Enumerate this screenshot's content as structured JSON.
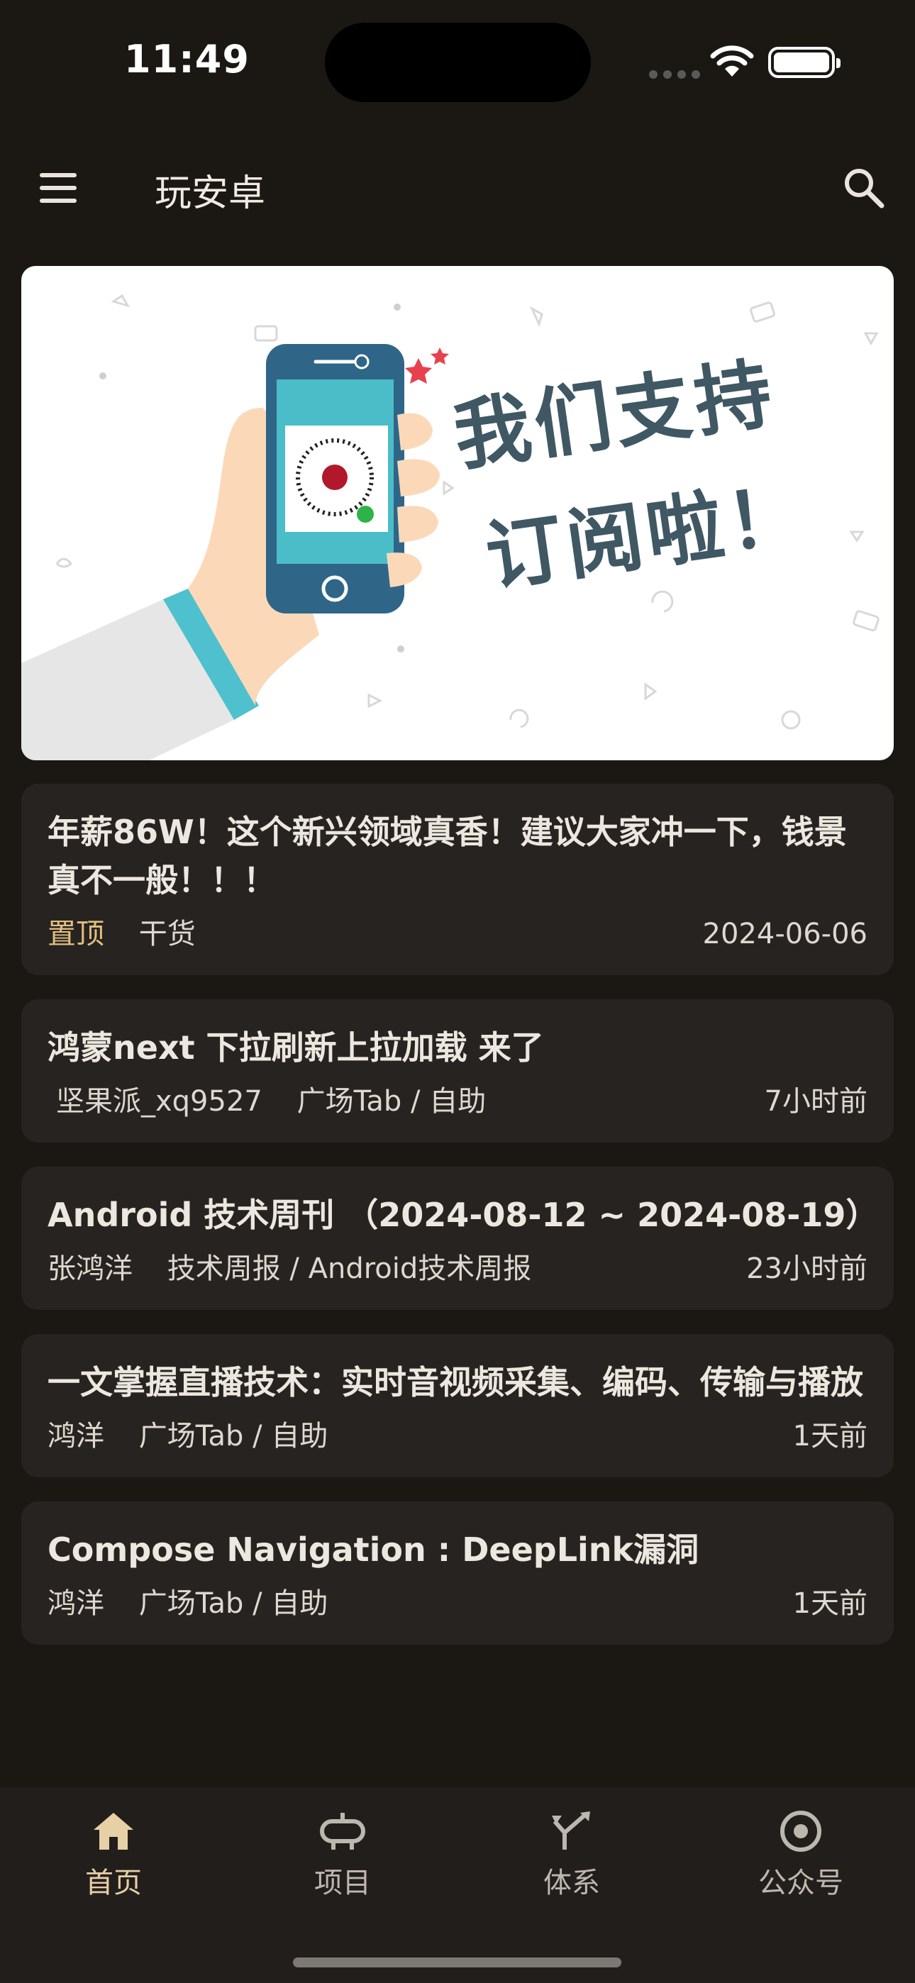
{
  "status_bar": {
    "time": "11:49"
  },
  "app_bar": {
    "title": "玩安卓"
  },
  "banner": {
    "line1": "我们支持",
    "line2": "订阅啦！"
  },
  "articles": [
    {
      "title": "年薪86W！这个新兴领域真香！建议大家冲一下，钱景真不一般！！！",
      "tag": "置顶",
      "category": "干货",
      "author": "",
      "date": "2024-06-06"
    },
    {
      "title": "鸿蒙next 下拉刷新上拉加载 来了",
      "tag": "",
      "author": "坚果派_xq9527",
      "category": "广场Tab / 自助",
      "date": "7小时前"
    },
    {
      "title": "Android 技术周刊 （2024-08-12 ~ 2024-08-19）",
      "tag": "",
      "author": "张鸿洋",
      "category": "技术周报 / Android技术周报",
      "date": "23小时前"
    },
    {
      "title": "一文掌握直播技术：实时音视频采集、编码、传输与播放",
      "tag": "",
      "author": "鸿洋",
      "category": "广场Tab / 自助",
      "date": "1天前"
    },
    {
      "title": "Compose Navigation : DeepLink漏洞",
      "tag": "",
      "author": "鸿洋",
      "category": "广场Tab / 自助",
      "date": "1天前"
    }
  ],
  "bottom_nav": [
    {
      "label": "首页",
      "icon": "home-icon",
      "active": true
    },
    {
      "label": "项目",
      "icon": "project-icon",
      "active": false
    },
    {
      "label": "体系",
      "icon": "system-icon",
      "active": false
    },
    {
      "label": "公众号",
      "icon": "official-account-icon",
      "active": false
    }
  ],
  "colors": {
    "background": "#1b1814",
    "card": "#272320",
    "accent": "#e1c07f",
    "banner_text": "#3f5863"
  }
}
